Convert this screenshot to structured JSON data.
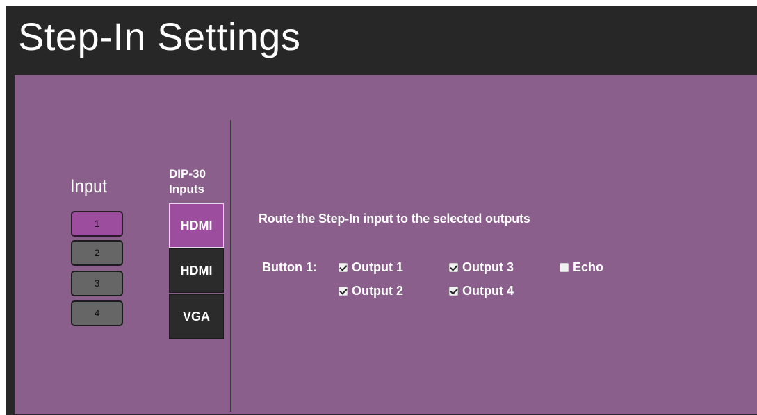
{
  "title": "Step-In Settings",
  "input_column": {
    "heading": "Input",
    "buttons": [
      {
        "label": "1",
        "selected": true
      },
      {
        "label": "2",
        "selected": false
      },
      {
        "label": "3",
        "selected": false
      },
      {
        "label": "4",
        "selected": false
      }
    ]
  },
  "dip_column": {
    "heading_line1": "DIP-30",
    "heading_line2": "Inputs",
    "inputs": [
      {
        "label": "HDMI",
        "active": true
      },
      {
        "label": "HDMI",
        "active": false
      },
      {
        "label": "VGA",
        "active": false
      }
    ]
  },
  "routing": {
    "description": "Route the Step-In input to the selected outputs",
    "button_label": "Button 1:",
    "options": [
      {
        "label": "Output 1",
        "checked": true
      },
      {
        "label": "Output 2",
        "checked": true
      },
      {
        "label": "Output 3",
        "checked": true
      },
      {
        "label": "Output 4",
        "checked": true
      },
      {
        "label": "Echo",
        "checked": false
      }
    ]
  },
  "colors": {
    "panel": "#8a5f8b",
    "header": "#272727",
    "selected": "#9d4d9d",
    "button": "#666666"
  }
}
